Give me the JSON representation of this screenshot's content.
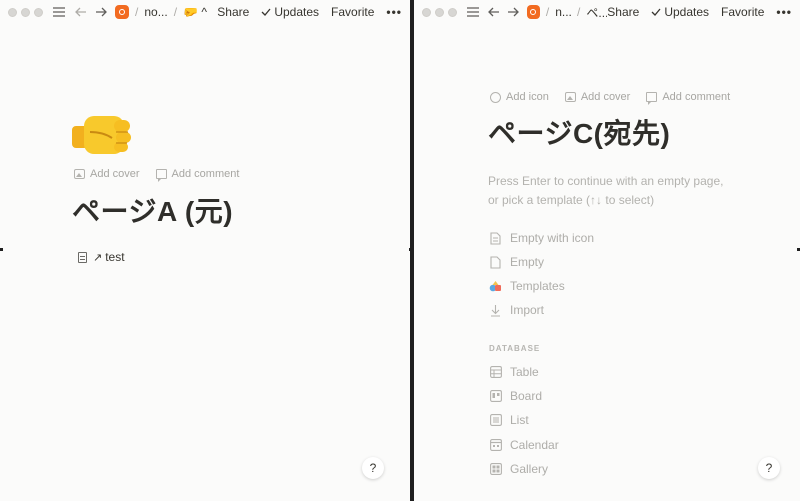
{
  "left": {
    "topbar": {
      "crumb_ws": "no...",
      "crumb_page": "🤛 ^",
      "share": "Share",
      "updates": "Updates",
      "favorite": "Favorite",
      "more": "•••"
    },
    "page": {
      "emoji": "fist-icon",
      "add_cover": "Add cover",
      "add_comment": "Add comment",
      "title": "ページA (元)",
      "link_arrow": "↗",
      "link_text": "test"
    },
    "help": "?"
  },
  "right": {
    "topbar": {
      "crumb_ws": "n...",
      "crumb_page": "ペ...",
      "share": "Share",
      "updates": "Updates",
      "favorite": "Favorite",
      "more": "•••"
    },
    "page": {
      "add_icon": "Add icon",
      "add_cover": "Add cover",
      "add_comment": "Add comment",
      "title": "ページC(宛先)",
      "hint_line1": "Press Enter to continue with an empty page,",
      "hint_line2": "or pick a template (↑↓ to select)",
      "menu": [
        "Empty with icon",
        "Empty",
        "Templates",
        "Import"
      ],
      "db_label": "DATABASE",
      "db_menu": [
        "Table",
        "Board",
        "List",
        "Calendar",
        "Gallery"
      ]
    },
    "help": "?"
  },
  "colors": {
    "background": "#fbfbfa",
    "text": "#37352f",
    "muted": "#aeada9",
    "brand": "#f26b21"
  }
}
